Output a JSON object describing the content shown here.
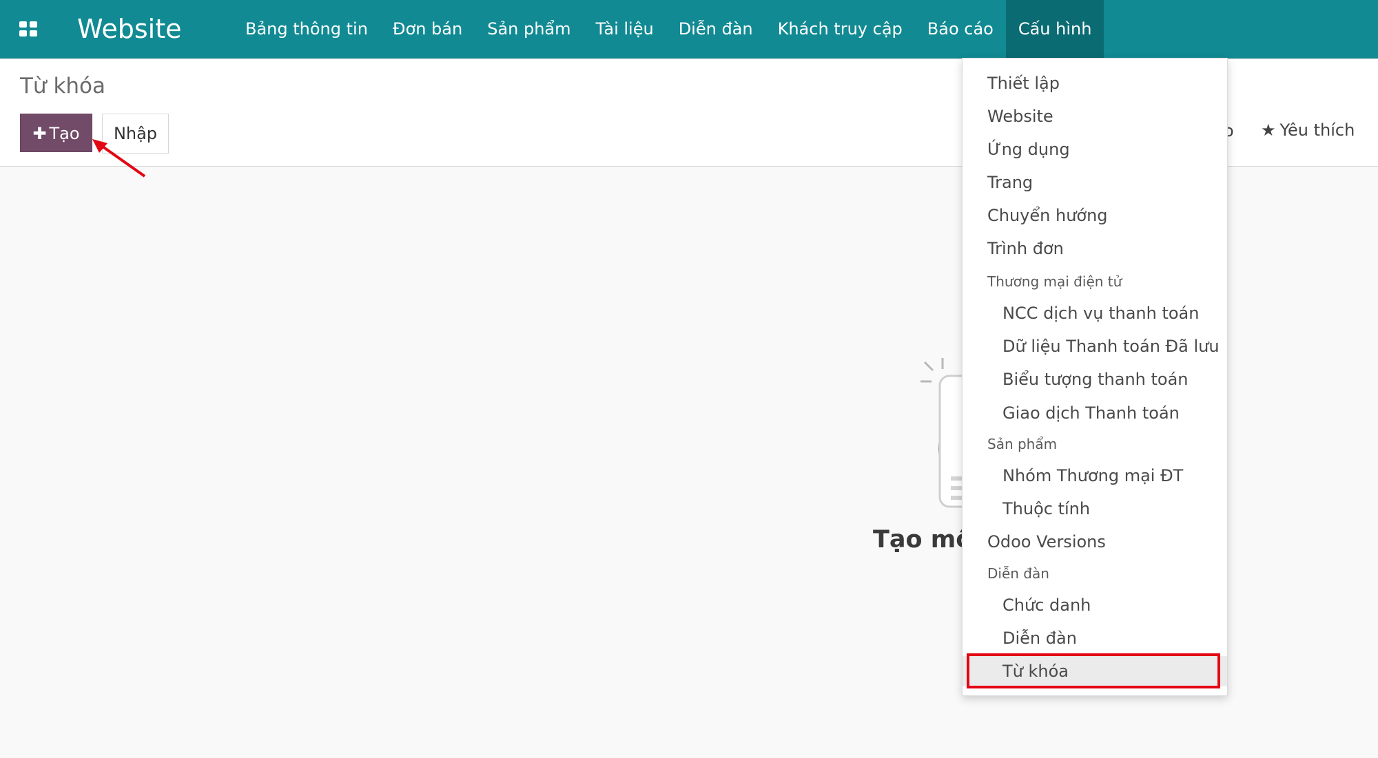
{
  "topbar": {
    "brand": "Website",
    "menu": [
      {
        "label": "Bảng thông tin"
      },
      {
        "label": "Đơn bán"
      },
      {
        "label": "Sản phẩm"
      },
      {
        "label": "Tài liệu"
      },
      {
        "label": "Diễn đàn"
      },
      {
        "label": "Khách truy cập"
      },
      {
        "label": "Báo cáo"
      },
      {
        "label": "Cấu hình",
        "active": true
      }
    ]
  },
  "control_panel": {
    "breadcrumb": "Từ khóa",
    "create_label": "Tạo",
    "import_label": "Nhập",
    "clipped_text": "o",
    "favorites_label": "Yêu thích"
  },
  "empty_state": {
    "title": "Tạo một"
  },
  "dropdown": {
    "item_thiet_lap": "Thiết lập",
    "item_website": "Website",
    "item_ung_dung": "Ứng dụng",
    "item_trang": "Trang",
    "item_chuyen_huong": "Chuyển hướng",
    "item_trinh_don": "Trình đơn",
    "header_tmdt": "Thương mại điện tử",
    "item_ncc": "NCC dịch vụ thanh toán",
    "item_du_lieu": "Dữ liệu Thanh toán Đã lưu",
    "item_bieu_tuong": "Biểu tượng thanh toán",
    "item_giao_dich": "Giao dịch Thanh toán",
    "header_san_pham": "Sản phẩm",
    "item_nhom": "Nhóm Thương mại ĐT",
    "item_thuoc_tinh": "Thuộc tính",
    "item_odoo_versions": "Odoo Versions",
    "header_dien_dan": "Diễn đàn",
    "item_chuc_danh": "Chức danh",
    "item_dien_dan": "Diễn đàn",
    "item_tu_khoa": "Từ khóa"
  },
  "colors": {
    "topbar": "#118a93",
    "active_menu": "#0b6b73",
    "primary_button": "#714b67",
    "annotation": "#e30613"
  }
}
